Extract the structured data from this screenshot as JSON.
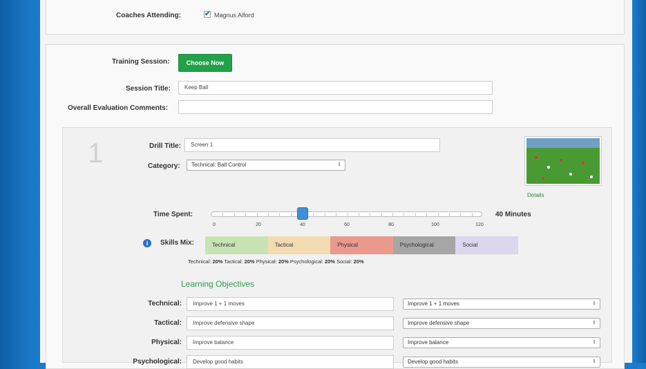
{
  "coaches": {
    "label": "Coaches Attending:",
    "coach_name": "Magnus Alford"
  },
  "training": {
    "session_label": "Training Session:",
    "choose_button": "Choose Now",
    "session_title_label": "Session Title:",
    "session_title_value": "Keep Ball",
    "comments_label": "Overall Evaluation Comments:",
    "comments_value": ""
  },
  "drill": {
    "number": "1",
    "title_label": "Drill Title:",
    "title_value": "Screen 1",
    "category_label": "Category:",
    "category_value": "Technical: Ball Control",
    "details_link": "Details",
    "time_label": "Time Spent:",
    "time_value": "40 Minutes",
    "time_minutes": 40,
    "time_max": 120,
    "time_ticks": [
      "0",
      "20",
      "40",
      "60",
      "80",
      "100",
      "120"
    ],
    "skills_label": "Skills Mix:",
    "skills": [
      {
        "name": "Technical",
        "pct_label": "Technical:",
        "pct": "20%",
        "color": "#c8e3b4"
      },
      {
        "name": "Tactical",
        "pct_label": "Tactical:",
        "pct": "20%",
        "color": "#f3dbb1"
      },
      {
        "name": "Physical",
        "pct_label": "Physical:",
        "pct": "20%",
        "color": "#ea9a8d"
      },
      {
        "name": "Psychological",
        "pct_label": "Psychological:",
        "pct": "20%",
        "color": "#a6a6a6"
      },
      {
        "name": "Social",
        "pct_label": "Social:",
        "pct": "20%",
        "color": "#dcd6ee"
      }
    ]
  },
  "objectives": {
    "title": "Learning Objectives",
    "rows": [
      {
        "label": "Technical:",
        "text": "Improve 1 + 1 moves",
        "select": "Improve 1 + 1 moves"
      },
      {
        "label": "Tactical:",
        "text": "Improve defensive shape",
        "select": "Improve defensive shape"
      },
      {
        "label": "Physical:",
        "text": "Improve balance",
        "select": "Improve balance"
      },
      {
        "label": "Psychological:",
        "text": "Develop good habits",
        "select": "Develop good habits"
      }
    ]
  },
  "colors": {
    "accent_green": "#23a04a",
    "slider_blue": "#3f8fd6",
    "frame_blue": "#1976c4"
  }
}
